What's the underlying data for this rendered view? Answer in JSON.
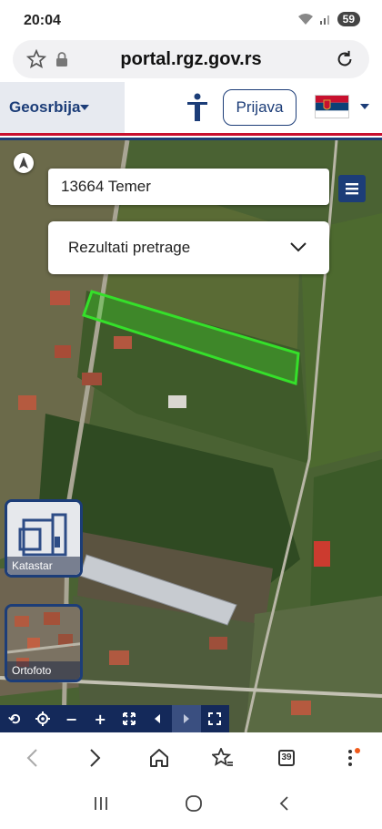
{
  "status_bar": {
    "time": "20:04",
    "battery": "59"
  },
  "browser": {
    "url": "portal.rgz.gov.rs",
    "tab_count": "39"
  },
  "header": {
    "brand": "Geosrbija",
    "login_label": "Prijava"
  },
  "map": {
    "search": {
      "value": "13664 Temer"
    },
    "results": {
      "label": "Rezultati pretrage"
    },
    "layers": [
      {
        "label": "Katastar"
      },
      {
        "label": "Ortofoto"
      }
    ],
    "toolbar": [
      "refresh",
      "locate",
      "zoom-out",
      "zoom-in",
      "full-extent",
      "previous",
      "next",
      "fullscreen"
    ]
  },
  "colors": {
    "brand": "#1c3d78",
    "parcel_highlight": "#35e02a",
    "flag_red": "#c8102e",
    "flag_blue": "#0c4076"
  }
}
